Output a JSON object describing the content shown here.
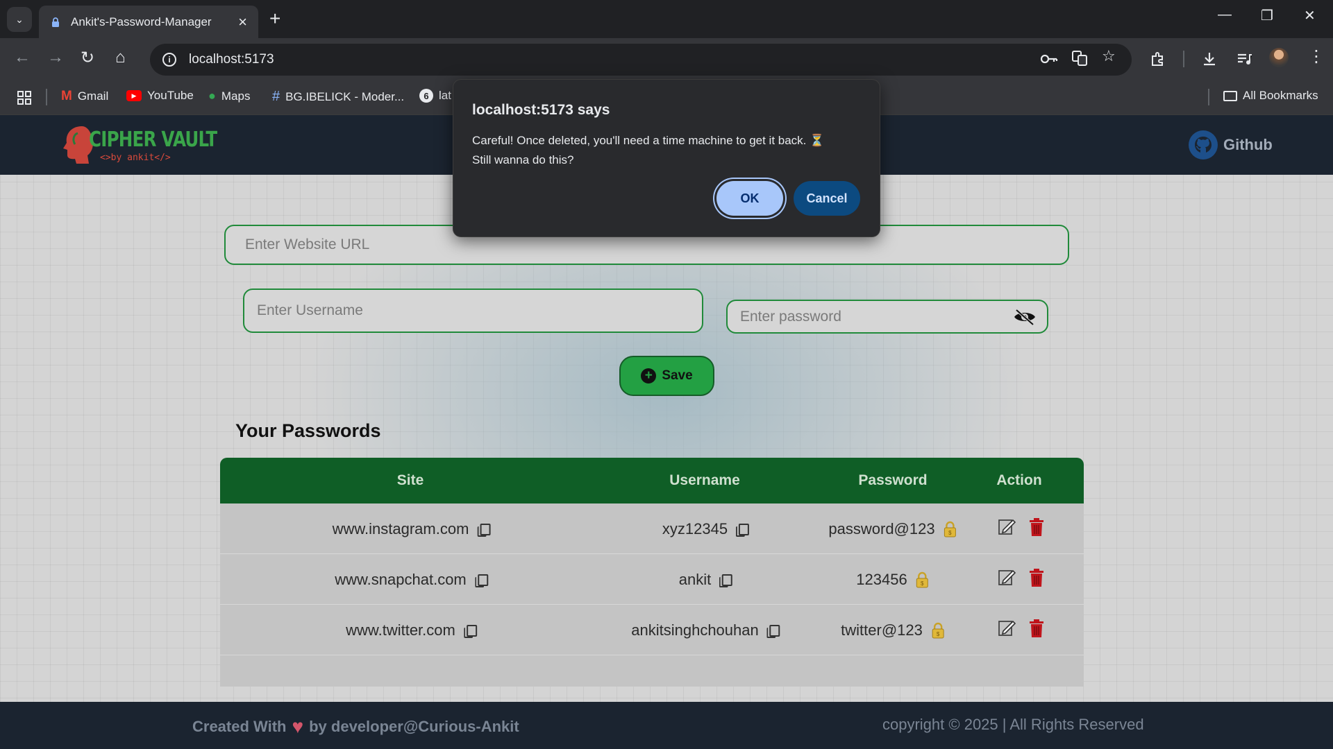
{
  "browser": {
    "tab_title": "Ankit's-Password-Manager",
    "url": "localhost:5173",
    "bookmarks": [
      {
        "label": "Gmail",
        "icon": "gmail-icon"
      },
      {
        "label": "YouTube",
        "icon": "youtube-icon"
      },
      {
        "label": "Maps",
        "icon": "maps-icon"
      },
      {
        "label": "BG.IBELICK - Moder...",
        "icon": "hash-icon"
      },
      {
        "label": "lat",
        "icon": "bookmark-icon"
      }
    ],
    "all_bookmarks": "All Bookmarks"
  },
  "site": {
    "logo_title": "CIPHER VAULT",
    "logo_sub": "<>by ankit</>",
    "github_label": "Github"
  },
  "form": {
    "url_placeholder": "Enter Website URL",
    "username_placeholder": "Enter Username",
    "password_placeholder": "Enter password",
    "save_label": "Save"
  },
  "passwords": {
    "heading": "Your Passwords",
    "columns": [
      "Site",
      "Username",
      "Password",
      "Action"
    ],
    "rows": [
      {
        "site": "www.instagram.com",
        "username": "xyz12345",
        "password": "password@123"
      },
      {
        "site": "www.snapchat.com",
        "username": "ankit",
        "password": "123456"
      },
      {
        "site": "www.twitter.com",
        "username": "ankitsinghchouhan",
        "password": "twitter@123"
      }
    ]
  },
  "footer": {
    "created_with": "Created With",
    "by": "by developer@Curious-Ankit",
    "copyright": "copyright © 2025 | All Rights Reserved"
  },
  "dialog": {
    "title": "localhost:5173 says",
    "message_line1": "Careful! Once deleted, you'll need a time machine to get it back. ⏳",
    "message_line2": "Still wanna do this?",
    "ok_label": "OK",
    "cancel_label": "Cancel"
  },
  "colors": {
    "accent_green": "#23a043",
    "header_green": "#0f5e26",
    "nav_bg": "#1b2430",
    "delete_red": "#c0141b",
    "dialog_ok": "#a8c7fa",
    "dialog_cancel": "#0c4a80"
  }
}
